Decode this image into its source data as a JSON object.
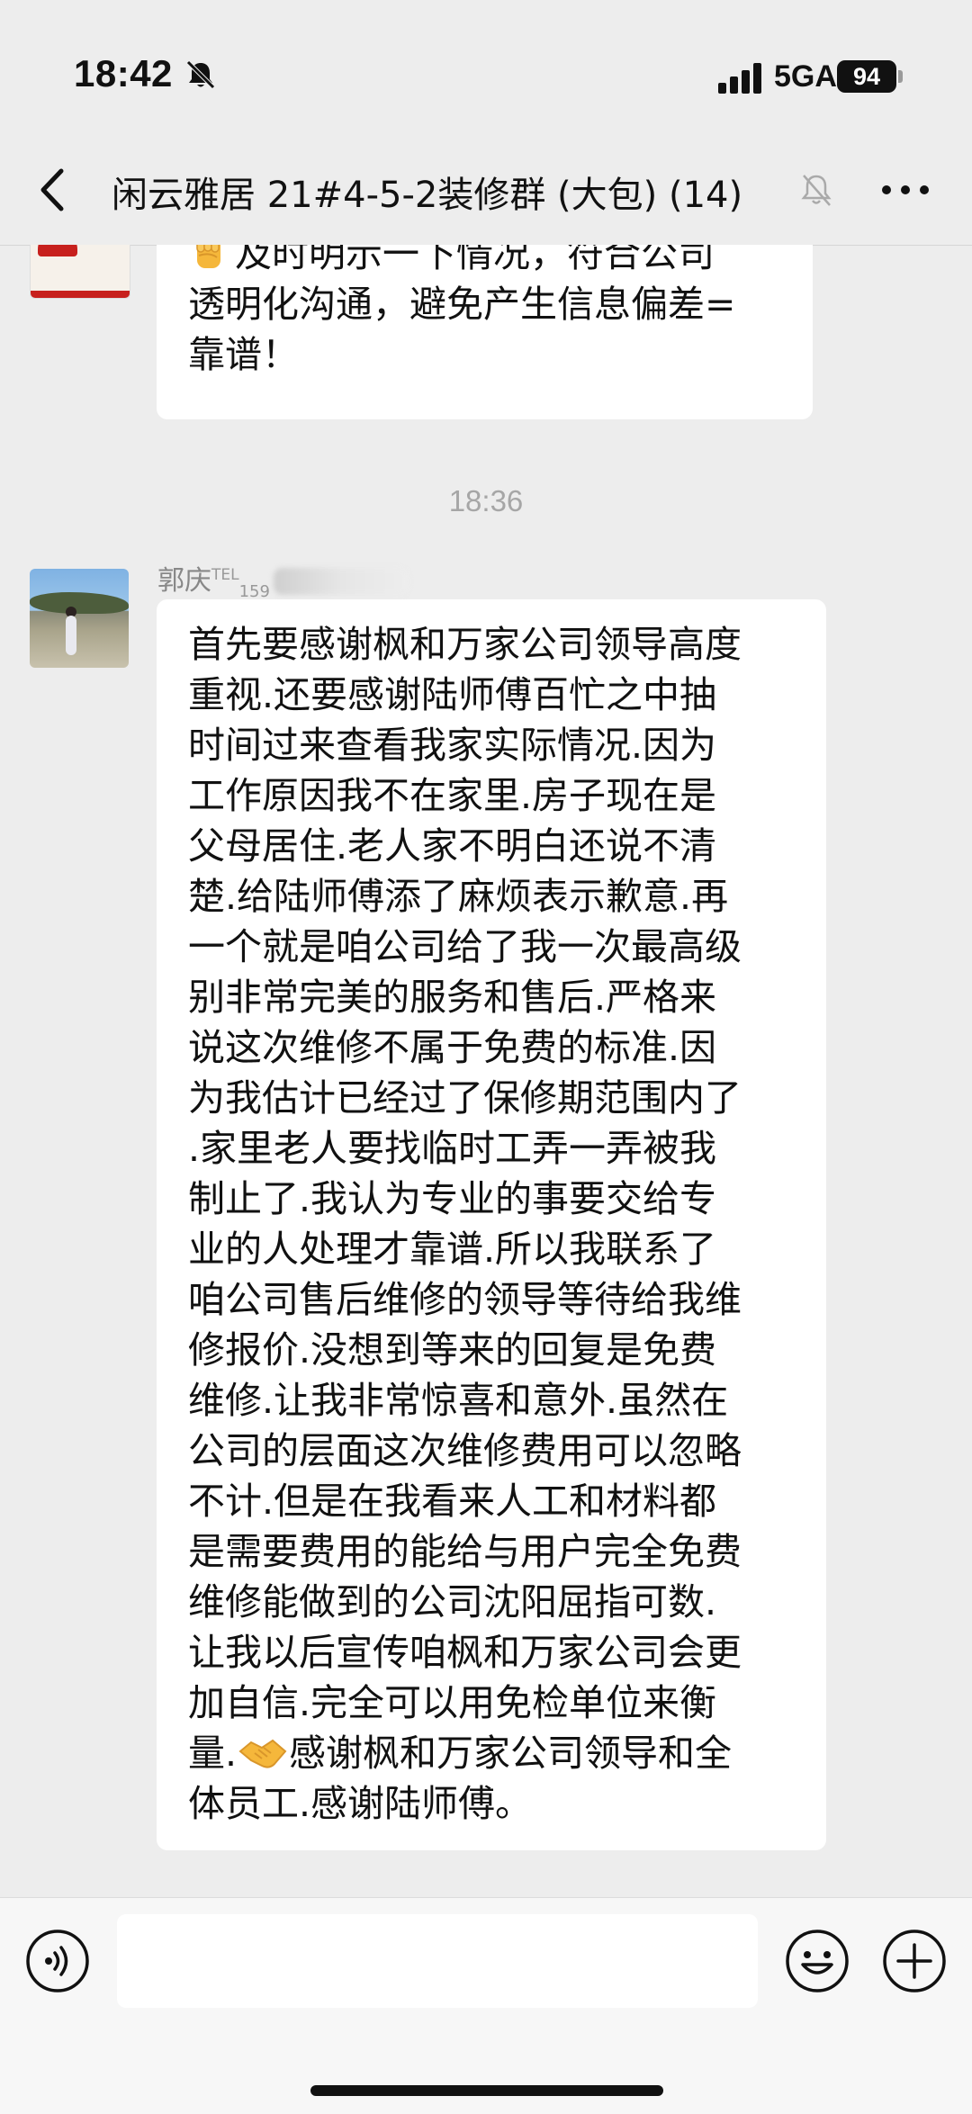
{
  "status_bar": {
    "time": "18:42",
    "network": "5GA",
    "battery_level": "94"
  },
  "header": {
    "title": "闲云雅居 21#4-5-2装修群 (大包) (14)"
  },
  "messages": {
    "msg1": {
      "lines": [
        "及时明示一下情况，符合公司",
        "透明化沟通，避免产生信息偏差=",
        "靠谱！"
      ],
      "emoji": "fist-emoji"
    },
    "timestamp": "18:36",
    "msg2": {
      "sender_name": "郭庆",
      "sender_suffix": "TEL",
      "sender_phone_partial": "159",
      "lines": [
        "首先要感谢枫和万家公司领导高度",
        "重视.还要感谢陆师傅百忙之中抽",
        "时间过来查看我家实际情况.因为",
        "工作原因我不在家里.房子现在是",
        "父母居住.老人家不明白还说不清",
        "楚.给陆师傅添了麻烦表示歉意.再",
        "一个就是咱公司给了我一次最高级",
        "别非常完美的服务和售后.严格来",
        "说这次维修不属于免费的标准.因",
        "为我估计已经过了保修期范围内了",
        ".家里老人要找临时工弄一弄被我",
        "制止了.我认为专业的事要交给专",
        "业的人处理才靠谱.所以我联系了",
        "咱公司售后维修的领导等待给我维",
        "修报价.没想到等来的回复是免费",
        "维修.让我非常惊喜和意外.虽然在",
        "公司的层面这次维修费用可以忽略",
        "不计.但是在我看来人工和材料都",
        "是需要费用的能给与用户完全免费",
        "维修能做到的公司沈阳屈指可数.",
        "让我以后宣传咱枫和万家公司会更",
        "加自信.完全可以用免检单位来衡"
      ],
      "line_23_before_emoji": "量.",
      "line_23_after_emoji": "感谢枫和万家公司领导和全",
      "last_line": "体员工.感谢陆师傅。",
      "emoji": "handshake-emoji"
    }
  },
  "input_bar": {
    "text_value": "",
    "placeholder": ""
  }
}
